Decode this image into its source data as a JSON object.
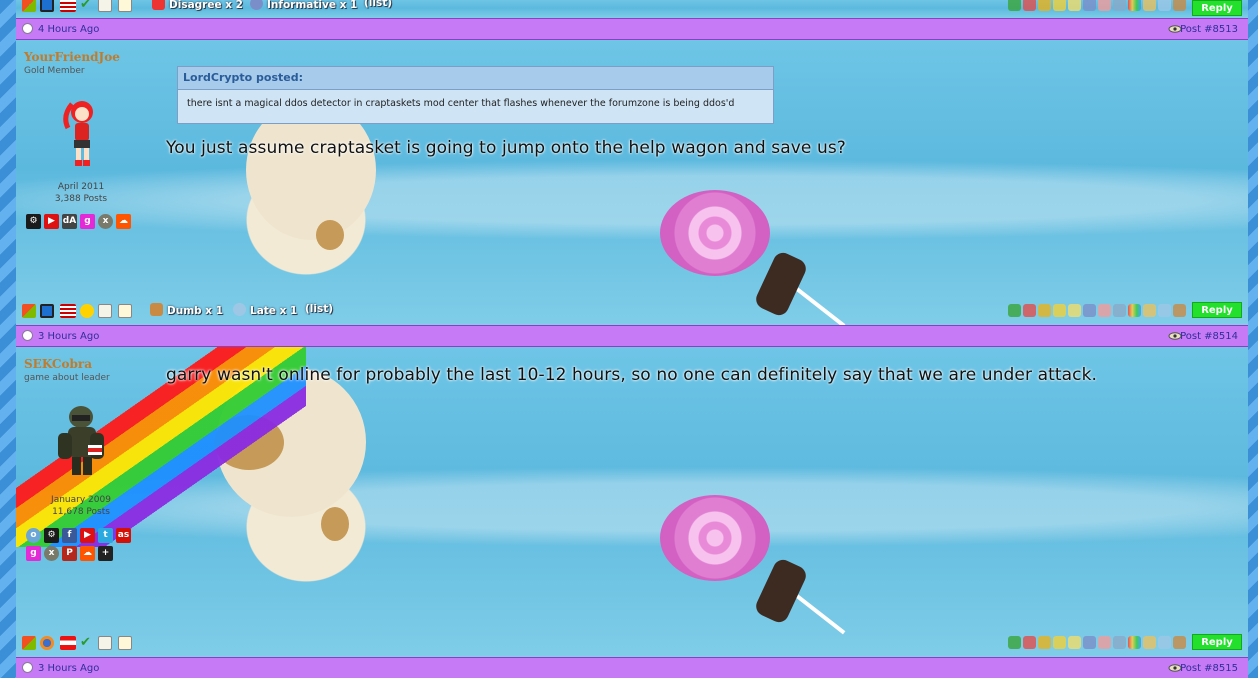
{
  "posts": [
    {
      "footer": {
        "ratings": [
          {
            "label": "Disagree x 2",
            "icon": "x-icon"
          },
          {
            "label": "Informative x 1",
            "icon": "info-icon"
          },
          {
            "label": "(list)"
          }
        ],
        "reply_label": "Reply"
      }
    },
    {
      "time": "4 Hours Ago",
      "post_number": "Post #8513",
      "user": {
        "name": "YourFriendJoe",
        "title": "Gold Member",
        "joined": "April 2011",
        "posts": "3,388 Posts"
      },
      "quote": {
        "author": "LordCrypto posted:",
        "text": "there isnt a magical ddos detector in craptaskets mod center that flashes whenever the forumzone is being ddos'd"
      },
      "message": "You just assume craptasket is going to jump onto the help wagon and save us?",
      "footer": {
        "ratings": [
          {
            "label": "Dumb x 1",
            "icon": "box-icon"
          },
          {
            "label": "Late x 1",
            "icon": "clock-icon"
          },
          {
            "label": "(list)"
          }
        ],
        "reply_label": "Reply"
      }
    },
    {
      "time": "3 Hours Ago",
      "post_number": "Post #8514",
      "user": {
        "name": "SEKCobra",
        "title": "game about leader",
        "joined": "January 2009",
        "posts": "11,678 Posts"
      },
      "message": "garry wasn't online for probably the last 10-12 hours, so no one can definitely say that we are under attack.",
      "footer": {
        "reply_label": "Reply"
      }
    },
    {
      "time": "3 Hours Ago",
      "post_number": "Post #8515"
    }
  ],
  "colors": {
    "header_bar": "#c77af5",
    "reply_button": "#22e02b",
    "username": "#c07b2b",
    "quote_bg": "#cfe4f5"
  }
}
